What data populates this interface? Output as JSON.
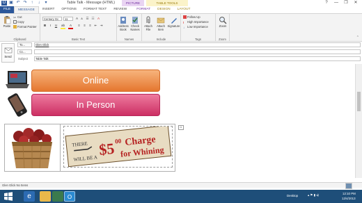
{
  "window": {
    "title": "Table Talk - Message (HTML)",
    "context_headers": {
      "picture": "PICTURE TOOLS",
      "table": "TABLE TOOLS"
    },
    "controls": [
      "?",
      "—",
      "❐",
      "✕"
    ]
  },
  "tabs": [
    "FILE",
    "MESSAGE",
    "INSERT",
    "OPTIONS",
    "FORMAT TEXT",
    "REVIEW",
    "FORMAT",
    "DESIGN",
    "LAYOUT"
  ],
  "active_tab": "MESSAGE",
  "ribbon": {
    "clipboard": {
      "paste": "Paste",
      "cut": "Cut",
      "copy": "Copy",
      "format_painter": "Format Painter",
      "label": "Clipboard"
    },
    "basic_text": {
      "font": "Century Gc",
      "size": "11",
      "bold": "B",
      "italic": "I",
      "underline": "U",
      "label": "Basic Text"
    },
    "names": {
      "address_book": "Address Book",
      "check_names": "Check Names",
      "label": "Names"
    },
    "include": {
      "attach_file": "Attach File",
      "attach_item": "Attach Item",
      "signature": "Signature",
      "label": "Include"
    },
    "tags": {
      "follow_up": "Follow Up",
      "high": "High Importance",
      "low": "Low Importance",
      "label": "Tags"
    },
    "zoom": {
      "zoom": "Zoom",
      "label": "Zoom"
    }
  },
  "fields": {
    "send": "Send",
    "to_label": "To...",
    "to_value": "Glen Glick",
    "cc_label": "Cc...",
    "cc_value": "",
    "subject_label": "Subject",
    "subject_value": "Table Talk"
  },
  "body": {
    "online": "Online",
    "in_person": "In Person",
    "sign_there": "THERE",
    "sign_willbe": "WILL BE A",
    "sign_amount": "$5",
    "sign_cents": "00",
    "sign_charge": "Charge",
    "sign_for": "for Whining"
  },
  "status": {
    "text": "Glen Glick  No Items"
  },
  "taskbar": {
    "desktop": "Desktop",
    "time": "12:10 PM",
    "date": "12/4/2013"
  },
  "colors": {
    "accent": "#2b579a",
    "online_orange": "#e5772f",
    "inperson_pink": "#cc2f63",
    "taskbar": "#1e4e79"
  }
}
